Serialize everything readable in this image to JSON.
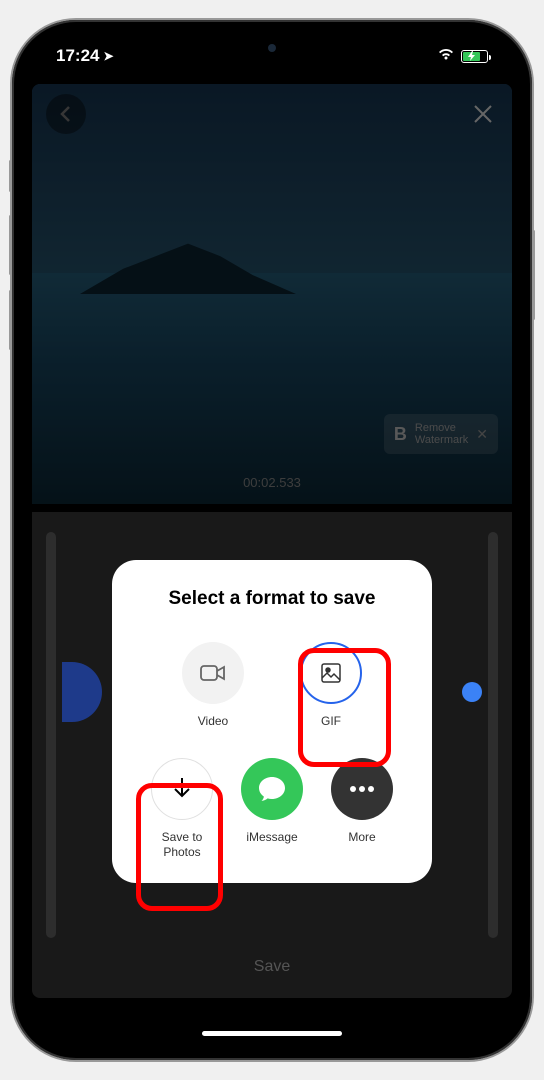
{
  "status": {
    "time": "17:24",
    "location_arrow": "↗"
  },
  "preview": {
    "timestamp": "00:02.533",
    "watermark": {
      "brand_letter": "B",
      "text": "Remove\nWatermark"
    }
  },
  "modal": {
    "title": "Select a format to save",
    "formats": {
      "video": "Video",
      "gif": "GIF"
    },
    "actions": {
      "save_photos": "Save to\nPhotos",
      "imessage": "iMessage",
      "more": "More"
    }
  },
  "bottom_button": "Save"
}
